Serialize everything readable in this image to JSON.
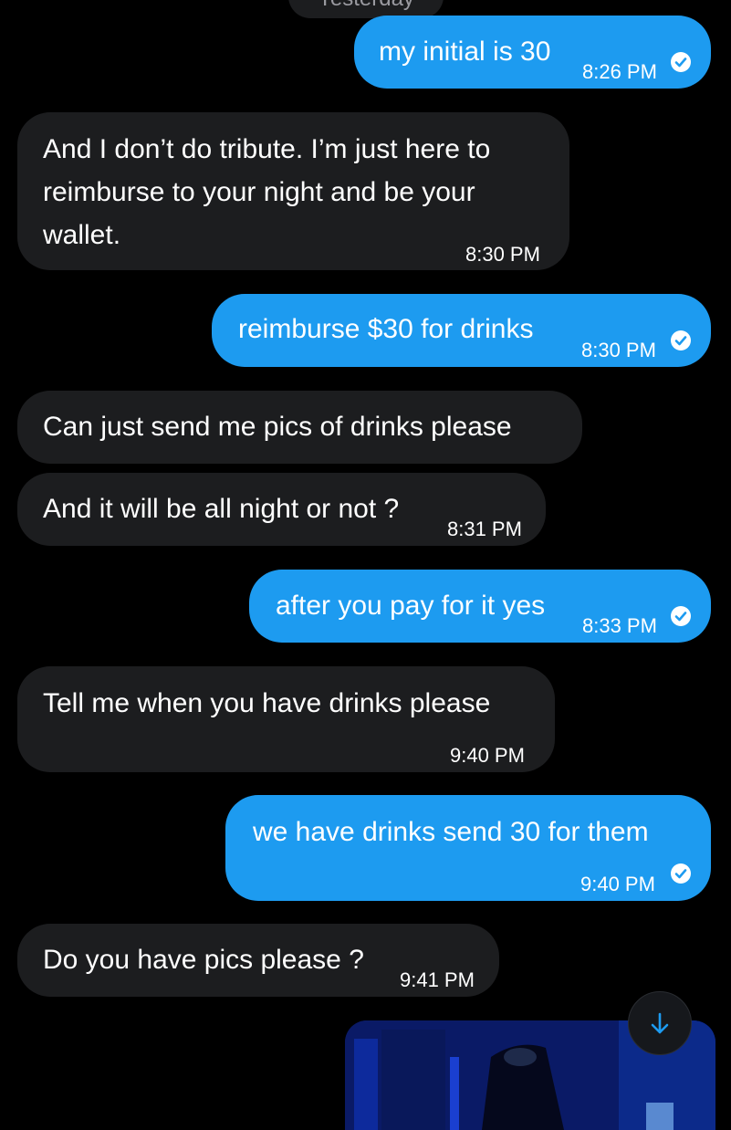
{
  "date_separator": "Yesterday",
  "colors": {
    "outgoing": "#1d9bf0",
    "incoming": "#1c1d1f",
    "background": "#000000"
  },
  "messages": [
    {
      "direction": "outgoing",
      "text": "my initial is 30",
      "time": "8:26 PM",
      "status": "read-check-icon"
    },
    {
      "direction": "incoming",
      "lines": [
        "And I don’t do tribute. I’m just here to",
        "reimburse to your night and be your",
        "wallet."
      ],
      "time": "8:30 PM"
    },
    {
      "direction": "outgoing",
      "text": "reimburse $30 for drinks",
      "time": "8:30 PM",
      "status": "read-check-icon"
    },
    {
      "direction": "incoming",
      "text": "Can just send me pics of drinks please"
    },
    {
      "direction": "incoming",
      "text": "And it will be all night or not ?",
      "time": "8:31 PM"
    },
    {
      "direction": "outgoing",
      "text": "after you pay for it yes",
      "time": "8:33 PM",
      "status": "read-check-icon"
    },
    {
      "direction": "incoming",
      "text": "Tell me when you have drinks please",
      "time": "9:40 PM"
    },
    {
      "direction": "outgoing",
      "text": "we have drinks send 30 for them",
      "time": "9:40 PM",
      "status": "read-check-icon"
    },
    {
      "direction": "incoming",
      "text": "Do you have pics please ?",
      "time": "9:41 PM"
    }
  ],
  "media_message": {
    "type": "image",
    "description_icon": "photo-icon"
  },
  "scroll_button": {
    "icon": "arrow-down-icon"
  }
}
